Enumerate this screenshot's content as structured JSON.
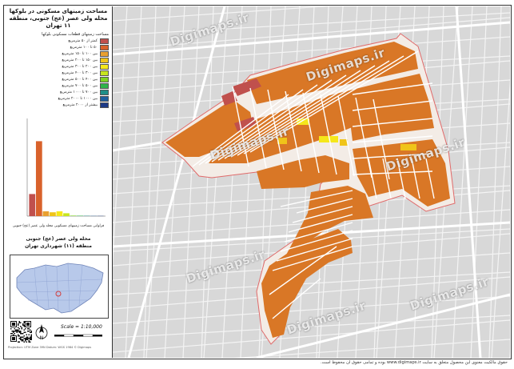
{
  "title": {
    "line1": "مساحت زمینهای مسکونی در بلوکها",
    "line2": "محله ولی عصر (عج) جنوبی، منطقه ۱۱ تهران"
  },
  "legend": {
    "header": "مساحت زمینهای قطعات مسکونی بلوکها",
    "items": [
      {
        "label": "کمتر از ۵۰ مترمربع",
        "color": "#c0504d"
      },
      {
        "label": "۵۰ تا ۱۰۰ مترمربع",
        "color": "#d9622b"
      },
      {
        "label": "بین ۱۰۰ تا ۱۵۰ مترمربع",
        "color": "#e9a030"
      },
      {
        "label": "بین ۱۵۰ تا ۲۰۰ مترمربع",
        "color": "#f0c419"
      },
      {
        "label": "بین ۲۰۰ تا ۳۰۰ مترمربع",
        "color": "#f5e71a"
      },
      {
        "label": "بین ۳۰۰ تا ۴۰۰ مترمربع",
        "color": "#c7e51f"
      },
      {
        "label": "بین ۴۰۰ تا ۵۰۰ مترمربع",
        "color": "#7fd323"
      },
      {
        "label": "بین ۵۰۰ تا ۷۰۰ مترمربع",
        "color": "#2fb34a"
      },
      {
        "label": "بین ۷۰۰ تا ۱۰۰۰ مترمربع",
        "color": "#1f8f88"
      },
      {
        "label": "بین ۱۰۰۰ تا ۲۰۰۰ مترمربع",
        "color": "#1f5f9f"
      },
      {
        "label": "بیشتر از ۲۰۰۰ مترمربع",
        "color": "#1d3a86"
      }
    ]
  },
  "chart_data": {
    "type": "bar",
    "categories": [
      "<50",
      "50-100",
      "100-150",
      "150-200",
      "200-300",
      "300-400",
      "400-500",
      "500-700",
      "700-1000",
      "1000-2000",
      ">2000"
    ],
    "values": [
      0.23,
      0.78,
      0.05,
      0.04,
      0.05,
      0.03,
      0.005,
      0.004,
      0.003,
      0.002,
      0.002
    ],
    "colors": [
      "#c0504d",
      "#d9622b",
      "#e9a030",
      "#f0c419",
      "#f5e71a",
      "#c7e51f",
      "#7fd323",
      "#2fb34a",
      "#1f8f88",
      "#1f5f9f",
      "#1d3a86"
    ],
    "ylim": [
      0,
      1
    ]
  },
  "caption": "فراوانی مساحت زمینهای مسکونی محله ولی عصر (عج) جنوبی",
  "sub1": "محله ولی عصر (عج) جنوبی",
  "sub2": "منطقه (۱۱) شهرداری تهران",
  "scale": "Scale = 1:10,000",
  "north_label": "N",
  "reference": "Projection: UTM  Zone 39N  Datum: WGS 1984  © Digimaps",
  "watermark_text": "Digimaps.ir",
  "footer": "حقوق مالکیت معنوی این محصول متعلق به سایت www.digimaps.ir بوده و تمامی حقوق آن محفوظ است."
}
